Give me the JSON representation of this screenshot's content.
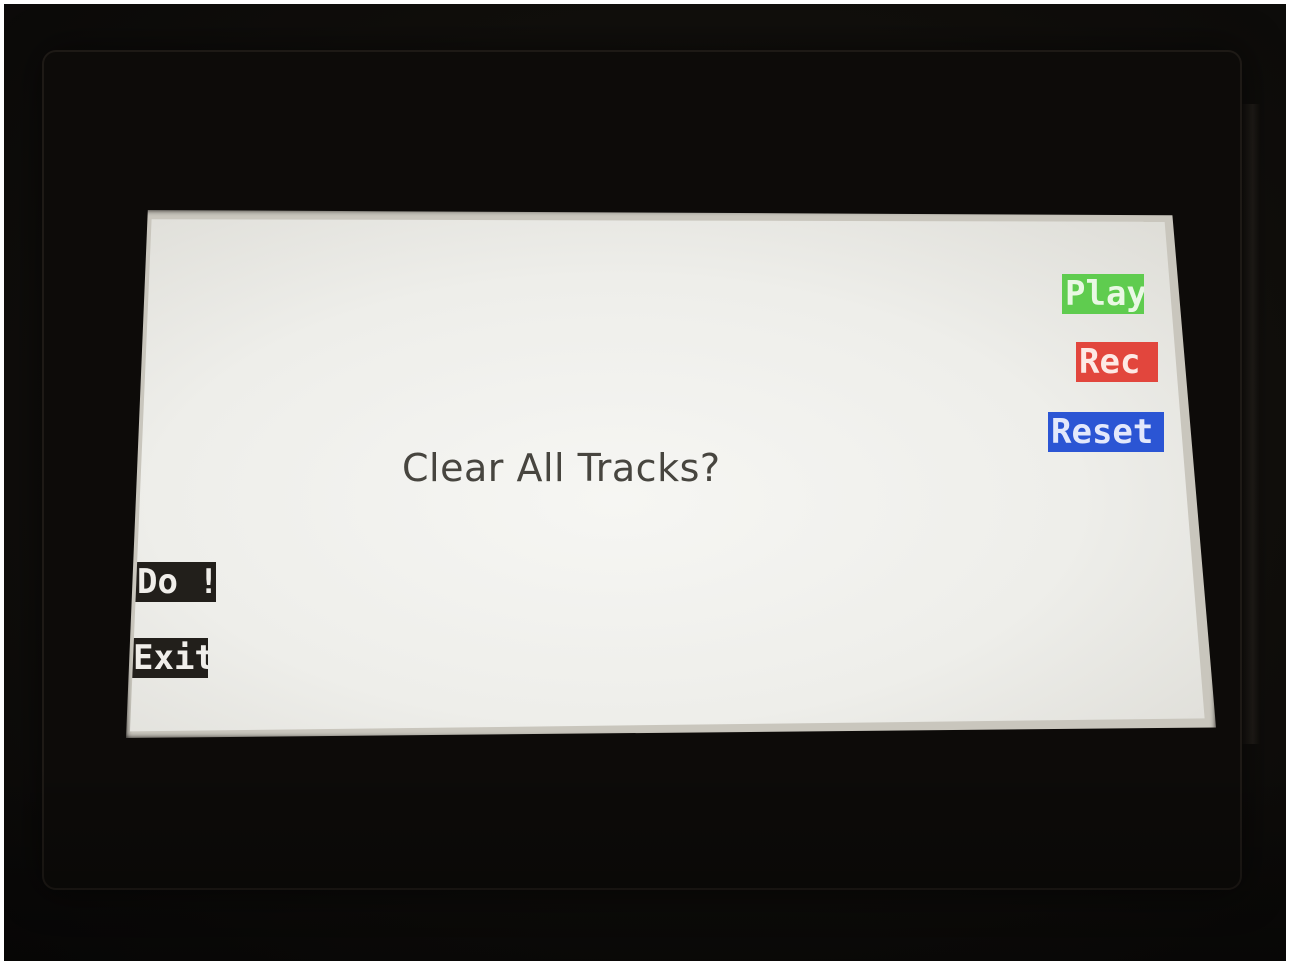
{
  "dialog": {
    "message": "Clear All Tracks?"
  },
  "softkeys": {
    "play": "Play",
    "rec": "Rec",
    "reset": "Reset",
    "do": "Do !",
    "exit": "Exit"
  },
  "colors": {
    "play": "#5fcc4f",
    "rec": "#e2463d",
    "reset": "#2b55d4",
    "left_keys": "#221f1b",
    "screen": "#eeeeea",
    "bezel": "#110f0c"
  }
}
